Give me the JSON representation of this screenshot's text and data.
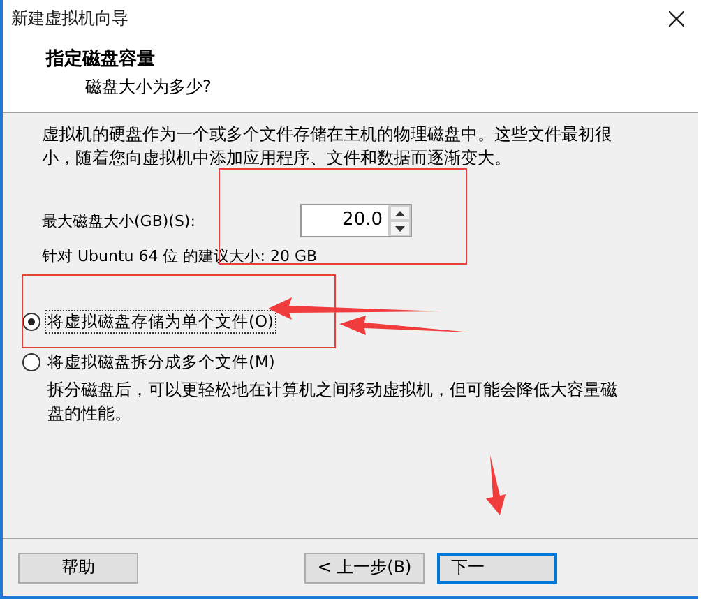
{
  "window": {
    "title": "新建虚拟机向导"
  },
  "header": {
    "title": "指定磁盘容量",
    "subtitle": "磁盘大小为多少?"
  },
  "description": "虚拟机的硬盘作为一个或多个文件存储在主机的物理磁盘中。这些文件最初很小，随着您向虚拟机中添加应用程序、文件和数据而逐渐变大。",
  "disk_size": {
    "label": "最大磁盘大小(GB)(S):",
    "value": "20.0"
  },
  "recommendation": "针对 Ubuntu 64 位 的建议大小: 20 GB",
  "options": [
    {
      "label": "将虚拟磁盘存储为单个文件(O)",
      "selected": true
    },
    {
      "label": "将虚拟磁盘拆分成多个文件(M)",
      "selected": false
    }
  ],
  "split_note": "拆分磁盘后，可以更轻松地在计算机之间移动虚拟机，但可能会降低大容量磁盘的性能。",
  "buttons": [
    {
      "label": "帮助",
      "focused": false
    },
    {
      "label": "< 上一步(B)",
      "focused": false
    },
    {
      "label": "下一",
      "focused": true
    }
  ],
  "annotations": [
    {
      "kind": "box"
    },
    {
      "kind": "box"
    },
    {
      "kind": "arrow"
    },
    {
      "kind": "arrow"
    },
    {
      "kind": "arrow"
    }
  ]
}
